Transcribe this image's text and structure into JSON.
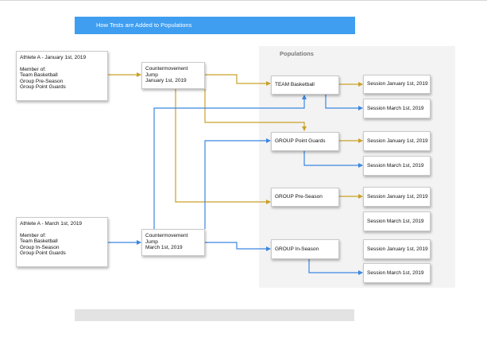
{
  "banner": {
    "title": "How Tests are Added to Populations"
  },
  "panel": {
    "title": "Populations"
  },
  "athletes": [
    {
      "name": "Athlete A - January 1st, 2019",
      "member_label": "Member of:",
      "groups": [
        "Team Basketball",
        "Group Pre-Season",
        "Group Point Guards"
      ]
    },
    {
      "name": "Athlete A - March 1st, 2019",
      "member_label": "Member of:",
      "groups": [
        "Team Basketball",
        "Group In-Season",
        "Group Point Guards"
      ]
    }
  ],
  "tests": [
    {
      "line1": "Countermovement Jump",
      "line2": "January 1st, 2019"
    },
    {
      "line1": "Countermovement Jump",
      "line2": "March 1st, 2019"
    }
  ],
  "populations": [
    {
      "label": "TEAM Basketball"
    },
    {
      "label": "GROUP Point Guards"
    },
    {
      "label": "GROUP Pre-Season"
    },
    {
      "label": "GROUP In-Season"
    }
  ],
  "sessions": [
    {
      "label": "Session January 1st, 2019"
    },
    {
      "label": "Session March 1st, 2019"
    },
    {
      "label": "Session January 1st, 2019"
    },
    {
      "label": "Session March 1st, 2019"
    },
    {
      "label": "Session January 1st, 2019"
    },
    {
      "label": "Session March 1st, 2019"
    },
    {
      "label": "Session January 1st, 2019"
    },
    {
      "label": "Session March 1st, 2019"
    }
  ],
  "colors": {
    "gold": "#c9a227",
    "blue": "#3b86e0",
    "banner": "#3f9ef0"
  }
}
